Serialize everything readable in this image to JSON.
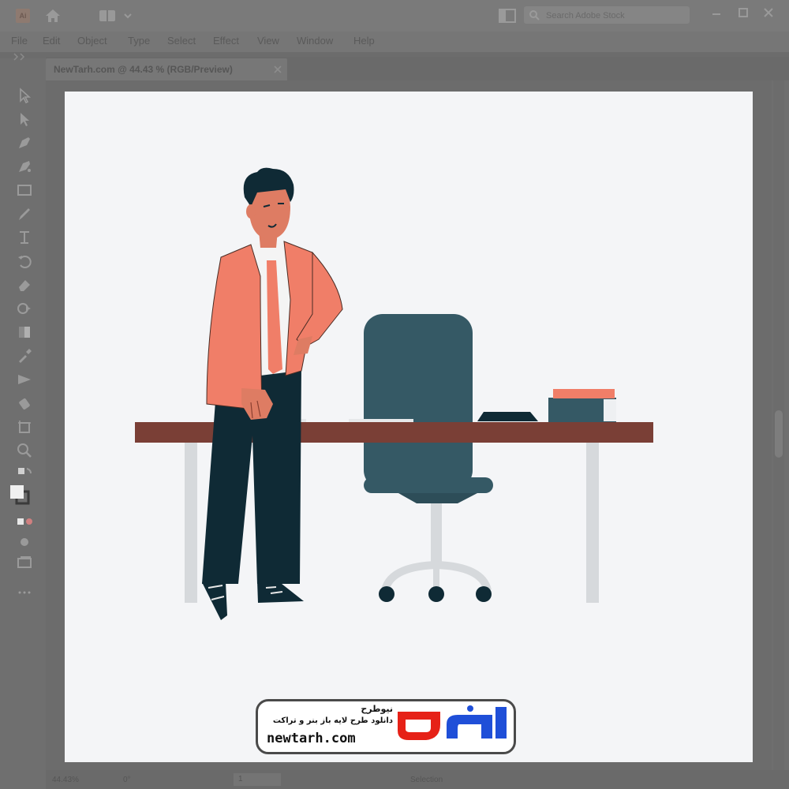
{
  "app": {
    "logo_text": "Ai",
    "search_placeholder": "Search Adobe Stock"
  },
  "menu": [
    "File",
    "Edit",
    "Object",
    "Type",
    "Select",
    "Effect",
    "View",
    "Window",
    "Help"
  ],
  "document_tab": {
    "label": "NewTarh.com @ 44.43 % (RGB/Preview)"
  },
  "status": {
    "zoom": "44.43%",
    "rotation": "0°",
    "artboard": "1",
    "mode": "Selection"
  },
  "icons": {
    "app": "illustrator-logo-icon",
    "home": "home-icon",
    "workspace": "workspace-switcher-icon",
    "search": "search-icon",
    "tools": [
      "selection-tool-icon",
      "direct-selection-tool-icon",
      "pen-tool-icon",
      "curvature-tool-icon",
      "rectangle-tool-icon",
      "paintbrush-tool-icon",
      "type-tool-icon",
      "rotate-tool-icon",
      "eraser-tool-icon",
      "shape-builder-tool-icon",
      "gradient-tool-icon",
      "eyedropper-tool-icon",
      "blend-tool-icon",
      "symbol-sprayer-tool-icon",
      "artboard-tool-icon",
      "zoom-tool-icon",
      "fill-stroke-icon",
      "draw-mode-icon",
      "screen-mode-icon",
      "edit-toolbar-icon"
    ]
  },
  "colors": {
    "chrome": "#6f6f6f",
    "artboard": "#f4f5f7",
    "jacket": "#f07e68",
    "skin": "#de7c63",
    "trousers": "#0f2a35",
    "chair": "#355965",
    "desk": "#7a3f36",
    "desk_legs": "#d6d9dc"
  },
  "watermark": {
    "brand_fa": "نیوطرح",
    "slogan_fa": "دانلود طرح لایه باز بنر و تراکت",
    "domain": "newtarh.com",
    "logo_fa": "نیوطرح"
  }
}
